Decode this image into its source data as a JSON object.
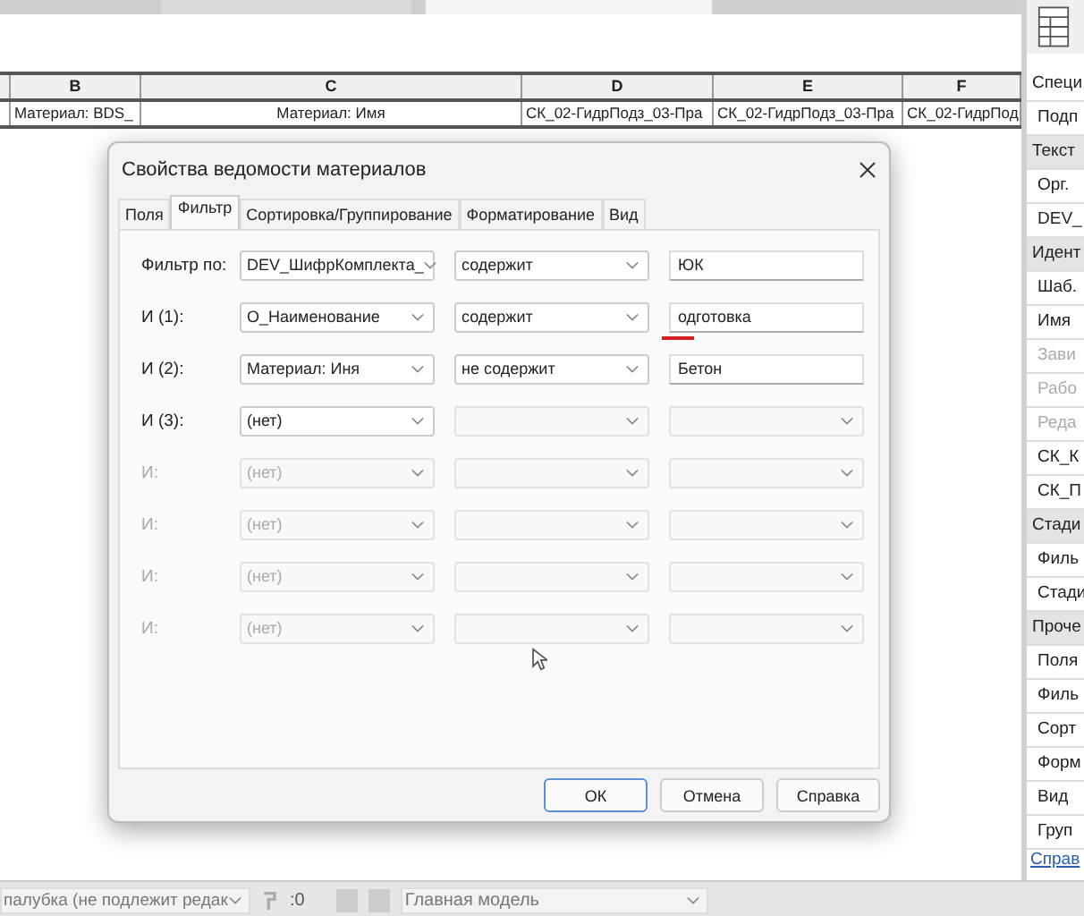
{
  "schedule": {
    "columns": [
      {
        "label": "B"
      },
      {
        "label": "C"
      },
      {
        "label": "D"
      },
      {
        "label": "E"
      },
      {
        "label": "F"
      }
    ],
    "row": [
      "Материал: BDS_",
      "Материал: Имя",
      "СК_02-ГидрПодз_03-Пра",
      "СК_02-ГидрПодз_03-Пра",
      "СК_02-ГидрПод"
    ]
  },
  "properties": {
    "items": [
      {
        "kind": "type",
        "text": "Специ",
        "disabled": false
      },
      {
        "kind": "item",
        "text": "Подп",
        "disabled": false
      },
      {
        "kind": "group",
        "text": "Текст",
        "disabled": false
      },
      {
        "kind": "item",
        "text": "Орг.",
        "disabled": false
      },
      {
        "kind": "item",
        "text": "DEV_",
        "disabled": false
      },
      {
        "kind": "group",
        "text": "Идент",
        "disabled": false
      },
      {
        "kind": "item",
        "text": "Шаб.",
        "disabled": false
      },
      {
        "kind": "item",
        "text": "Имя",
        "disabled": false
      },
      {
        "kind": "item",
        "text": "Зави",
        "disabled": true
      },
      {
        "kind": "item",
        "text": "Рабо",
        "disabled": true
      },
      {
        "kind": "item",
        "text": "Реда",
        "disabled": true
      },
      {
        "kind": "item",
        "text": "СК_К",
        "disabled": false
      },
      {
        "kind": "item",
        "text": "СК_П",
        "disabled": false
      },
      {
        "kind": "group",
        "text": "Стади",
        "disabled": false
      },
      {
        "kind": "item",
        "text": "Филь",
        "disabled": false
      },
      {
        "kind": "item",
        "text": "Стади",
        "disabled": false
      },
      {
        "kind": "group",
        "text": "Проче",
        "disabled": false
      },
      {
        "kind": "item",
        "text": "Поля",
        "disabled": false
      },
      {
        "kind": "item",
        "text": "Филь",
        "disabled": false
      },
      {
        "kind": "item",
        "text": "Сорт",
        "disabled": false
      },
      {
        "kind": "item",
        "text": "Форм",
        "disabled": false
      },
      {
        "kind": "item",
        "text": "Вид",
        "disabled": false
      },
      {
        "kind": "item",
        "text": "Груп",
        "disabled": false
      }
    ],
    "link": "Справ"
  },
  "status_bar": {
    "workset": "палубка (не подлежит редак",
    "count": ":0",
    "model": "Главная модель"
  },
  "dialog": {
    "title": "Свойства ведомости материалов",
    "tabs": [
      {
        "label": "Поля",
        "selected": false
      },
      {
        "label": "Фильтр",
        "selected": true
      },
      {
        "label": "Сортировка/Группирование",
        "selected": false
      },
      {
        "label": "Форматирование",
        "selected": false
      },
      {
        "label": "Вид",
        "selected": false
      }
    ],
    "filters": [
      {
        "label": "Фильтр по:",
        "field": "DEV_ШифрКомплекта_",
        "condition": "содержит",
        "value": "ЮК",
        "disabled": false,
        "spell_error": false
      },
      {
        "label": "И (1):",
        "field": "О_Наименование",
        "condition": "содержит",
        "value": "одготовка",
        "disabled": false,
        "spell_error": true
      },
      {
        "label": "И (2):",
        "field": "Материал: Иня",
        "condition": "не содержит",
        "value": "Бетон",
        "disabled": false,
        "spell_error": false
      },
      {
        "label": "И (3):",
        "field": "(нет)",
        "disabled": false,
        "spell_error": false
      },
      {
        "label": "И:",
        "field": "(нет)",
        "disabled": true,
        "spell_error": false
      },
      {
        "label": "И:",
        "field": "(нет)",
        "disabled": true,
        "spell_error": false
      },
      {
        "label": "И:",
        "field": "(нет)",
        "disabled": true,
        "spell_error": false
      },
      {
        "label": "И:",
        "field": "(нет)",
        "disabled": true,
        "spell_error": false
      }
    ],
    "buttons": [
      {
        "label": "ОК",
        "default": true
      },
      {
        "label": "Отмена",
        "default": false
      },
      {
        "label": "Справка",
        "default": false
      }
    ]
  }
}
